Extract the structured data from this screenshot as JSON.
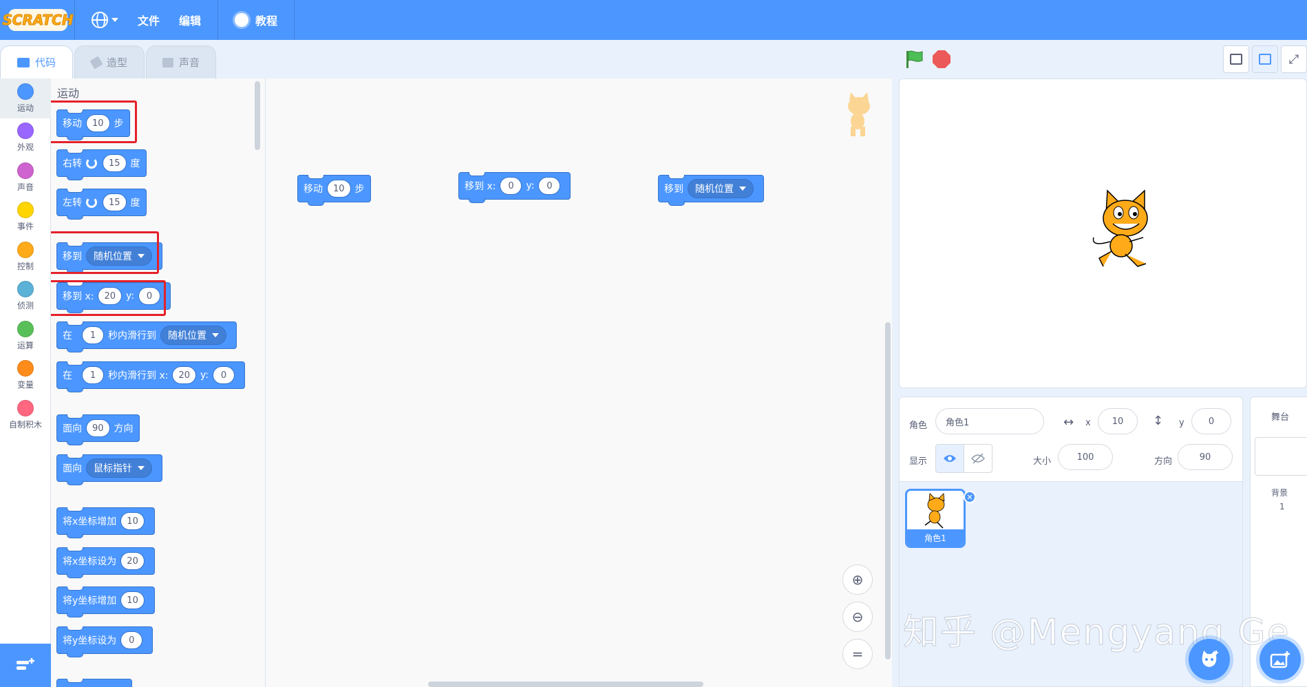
{
  "menubar": {
    "logo": "SCRATCH",
    "file": "文件",
    "edit": "编辑",
    "tutorials": "教程"
  },
  "tabs": {
    "code": "代码",
    "costumes": "造型",
    "sounds": "声音"
  },
  "categories": [
    {
      "label": "运动",
      "color": "#4c97ff"
    },
    {
      "label": "外观",
      "color": "#9966ff"
    },
    {
      "label": "声音",
      "color": "#cf63cf"
    },
    {
      "label": "事件",
      "color": "#ffd500"
    },
    {
      "label": "控制",
      "color": "#ffab19"
    },
    {
      "label": "侦测",
      "color": "#5cb1d6"
    },
    {
      "label": "运算",
      "color": "#59c059"
    },
    {
      "label": "变量",
      "color": "#ff8c1a"
    },
    {
      "label": "自制积木",
      "color": "#ff6680"
    }
  ],
  "palette": {
    "title": "运动",
    "move": {
      "pre": "移动",
      "val": "10",
      "post": "步"
    },
    "turn_right": {
      "pre": "右转",
      "val": "15",
      "post": "度"
    },
    "turn_left": {
      "pre": "左转",
      "val": "15",
      "post": "度"
    },
    "goto": {
      "pre": "移到",
      "opt": "随机位置"
    },
    "gotoxy": {
      "pre": "移到 x:",
      "x": "20",
      "ymid": "y:",
      "y": "0"
    },
    "glide": {
      "pre": "在",
      "secs": "1",
      "mid": "秒内滑行到",
      "opt": "随机位置"
    },
    "glidexy": {
      "pre": "在",
      "secs": "1",
      "mid": "秒内滑行到 x:",
      "x": "20",
      "ymid": "y:",
      "y": "0"
    },
    "point": {
      "pre": "面向",
      "val": "90",
      "post": "方向"
    },
    "pointto": {
      "pre": "面向",
      "opt": "鼠标指针"
    },
    "changex": {
      "pre": "将x坐标增加",
      "val": "10"
    },
    "setx": {
      "pre": "将x坐标设为",
      "val": "20"
    },
    "changey": {
      "pre": "将y坐标增加",
      "val": "10"
    },
    "sety": {
      "pre": "将y坐标设为",
      "val": "0"
    }
  },
  "workspace": {
    "move": {
      "pre": "移动",
      "val": "10",
      "post": "步"
    },
    "gotoxy": {
      "pre": "移到 x:",
      "x": "0",
      "ymid": "y:",
      "y": "0"
    },
    "goto": {
      "pre": "移到",
      "opt": "随机位置"
    }
  },
  "sprite_info": {
    "sprite_label": "角色",
    "sprite_name": "角色1",
    "x_label": "x",
    "x": "10",
    "y_label": "y",
    "y": "0",
    "show_label": "显示",
    "size_label": "大小",
    "size": "100",
    "direction_label": "方向",
    "direction": "90"
  },
  "sprites": [
    {
      "name": "角色1"
    }
  ],
  "stage_pane": {
    "title": "舞台",
    "backdrop_label": "背景",
    "backdrop_count": "1"
  },
  "watermark": "知乎 @Mengyang Ge",
  "colors": {
    "accent": "#4c97ff",
    "motion_block": "#4c97ff",
    "highlight": "#e5202a"
  }
}
